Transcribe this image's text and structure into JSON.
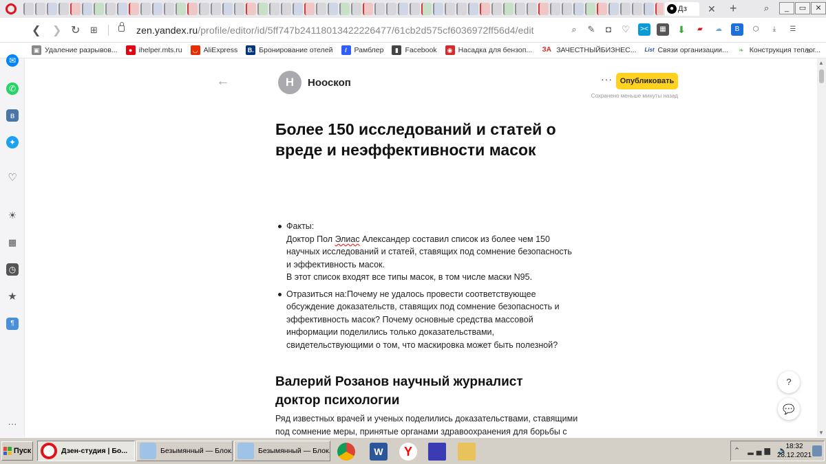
{
  "browser": {
    "active_tab_label": "Дз",
    "url_host": "zen.yandex.ru",
    "url_path": "/profile/editor/id/5ff747b24118013422226477/61cb2d575cf6036972ff56d4/edit",
    "tab_close_glyph": "✕",
    "new_tab_glyph": "+",
    "search_glyph": "⌕"
  },
  "bookmarks": [
    {
      "label": "Удаление разрывов...",
      "color": "#888888",
      "icon": "bookmark-page-icon"
    },
    {
      "label": "ihelper.mts.ru",
      "color": "#e30611",
      "icon": "mts-icon"
    },
    {
      "label": "AliExpress",
      "color": "#e62e04",
      "icon": "aliexpress-icon"
    },
    {
      "label": "Бронирование отелей",
      "color": "#003580",
      "icon": "booking-icon"
    },
    {
      "label": "Рамблер",
      "color": "#315efb",
      "icon": "rambler-icon"
    },
    {
      "label": "Facebook",
      "color": "#444444",
      "icon": "page-icon"
    },
    {
      "label": "Насадка для бензоп...",
      "color": "#d62b2b",
      "icon": "pin-icon"
    },
    {
      "label": "ЗАЧЕСТНЫЙБИЗНЕС...",
      "color": "#ffffff",
      "icon": "za-icon",
      "prefix": "ЗА"
    },
    {
      "label": "Связи организации...",
      "color": "#1f4e9c",
      "icon": "list-org-icon"
    },
    {
      "label": "Конструкция теплог...",
      "color": "#7bb661",
      "icon": "leaf-icon"
    }
  ],
  "editor": {
    "channel_initial": "Н",
    "channel_name": "Нооскоп",
    "publish_label": "Опубликовать",
    "save_status": "Сохранено меньше минуты назад",
    "title": "Более 150  исследований и статей о вреде и неэффективности масок",
    "bullet_1": {
      "heading": "Факты:",
      "line_1_a": "Доктор Пол ",
      "line_1_b": "Элиас",
      "line_1_c": " Александер составил список из более чем 150",
      "line_2": "научных исследований и статей, ставящих под сомнение безопасность",
      "line_3": "и эффективность масок.",
      "line_4": "В этот список входят все типы масок, в том числе маски N95."
    },
    "bullet_2": {
      "line_1": "Отразиться на:Почему не удалось провести соответствующее",
      "line_2": "обсуждение доказательств, ставящих под сомнение безопасность и",
      "line_3": "эффективность масок? Почему основные средства массовой",
      "line_4": "информации поделились только доказательствами,",
      "line_5": "свидетельствующими о том, что маскировка может быть полезной?"
    },
    "section_heading_1": "Валерий Розанов научный журналист",
    "section_heading_2": "доктор психологии",
    "section_body_1": "Ряд известных врачей и ученых поделились доказательствами, ставящими",
    "section_body_2": "под сомнение меры, принятые органами здравоохранения для борьбы с",
    "help_label": "?"
  },
  "taskbar": {
    "start_label": "Пуск",
    "tasks": [
      {
        "label": "Дзен-студия | Бо...",
        "active": true
      },
      {
        "label": "Безымянный — Блок...",
        "active": false
      },
      {
        "label": "Безымянный — Блок...",
        "active": false
      }
    ],
    "time": "18:32",
    "date": "28.12.2021"
  },
  "colors": {
    "publish_button": "#ffd21f",
    "opera_red": "#e0131b"
  }
}
